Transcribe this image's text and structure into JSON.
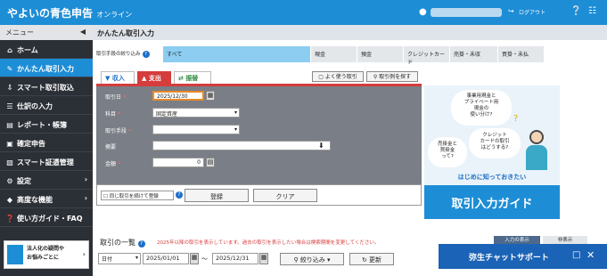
{
  "header": {
    "logo_main": "やよいの青色申告",
    "logo_sub": "オンライン",
    "logout": "ログアウト"
  },
  "nav": {
    "menu_label": "メニュー",
    "items": [
      {
        "label": "ホーム",
        "icon": "home-icon"
      },
      {
        "label": "かんたん取引入力",
        "icon": "pencil-icon"
      },
      {
        "label": "スマート取引取込",
        "icon": "import-icon"
      },
      {
        "label": "仕訳の入力",
        "icon": "journal-icon"
      },
      {
        "label": "レポート・帳簿",
        "icon": "report-icon"
      },
      {
        "label": "確定申告",
        "icon": "tax-icon"
      },
      {
        "label": "スマート証憑管理",
        "icon": "document-icon"
      },
      {
        "label": "設定",
        "icon": "gear-icon"
      },
      {
        "label": "高度な機能",
        "icon": "advanced-icon"
      },
      {
        "label": "使い方ガイド・FAQ",
        "icon": "help-icon"
      }
    ],
    "promo": "法人化の疑問や\nお悩みごとに"
  },
  "page": {
    "title": "かんたん取引入力"
  },
  "filter": {
    "label": "取引手段の絞り込み",
    "tabs": [
      "すべて",
      "現金",
      "預金",
      "クレジットカード",
      "売掛・未収",
      "買掛・未払"
    ]
  },
  "entry_tabs": [
    "収入",
    "支出",
    "振替"
  ],
  "tools": {
    "frequent": "よく使う取引",
    "examples": "取引例を探す"
  },
  "form": {
    "date_label": "取引日",
    "date_value": "2025/12/30",
    "account_label": "科目",
    "account_value": "固定資産",
    "method_label": "取引手段",
    "method_value": "",
    "memo_label": "摘要",
    "memo_value": "",
    "amount_label": "金額",
    "amount_value": "0",
    "continue_label": "同じ取引を続けて登録",
    "register": "登録",
    "clear": "クリア"
  },
  "guide": {
    "bubble1": "事業用現金と\nプライベート用\n現金の\n使い分け?",
    "bubble2": "売掛金と\n買掛金\nって?",
    "bubble3": "クレジット\nカードの取引\nはどうする?",
    "sub": "はじめに知っておきたい",
    "title": "取引入力ガイド"
  },
  "list": {
    "title": "取引の一覧",
    "notice": "2025年以降の取引を表示しています。過去の取引を表示したい場合は検索期間を変更してください。",
    "view_input": "入力の表示",
    "view_sub": "非表示",
    "period_type": "日付",
    "date_from": "2025/01/01",
    "date_to": "2025/12/31",
    "filter": "絞り込み",
    "refresh": "更新"
  },
  "chat": {
    "title": "弥生チャットサポート"
  }
}
